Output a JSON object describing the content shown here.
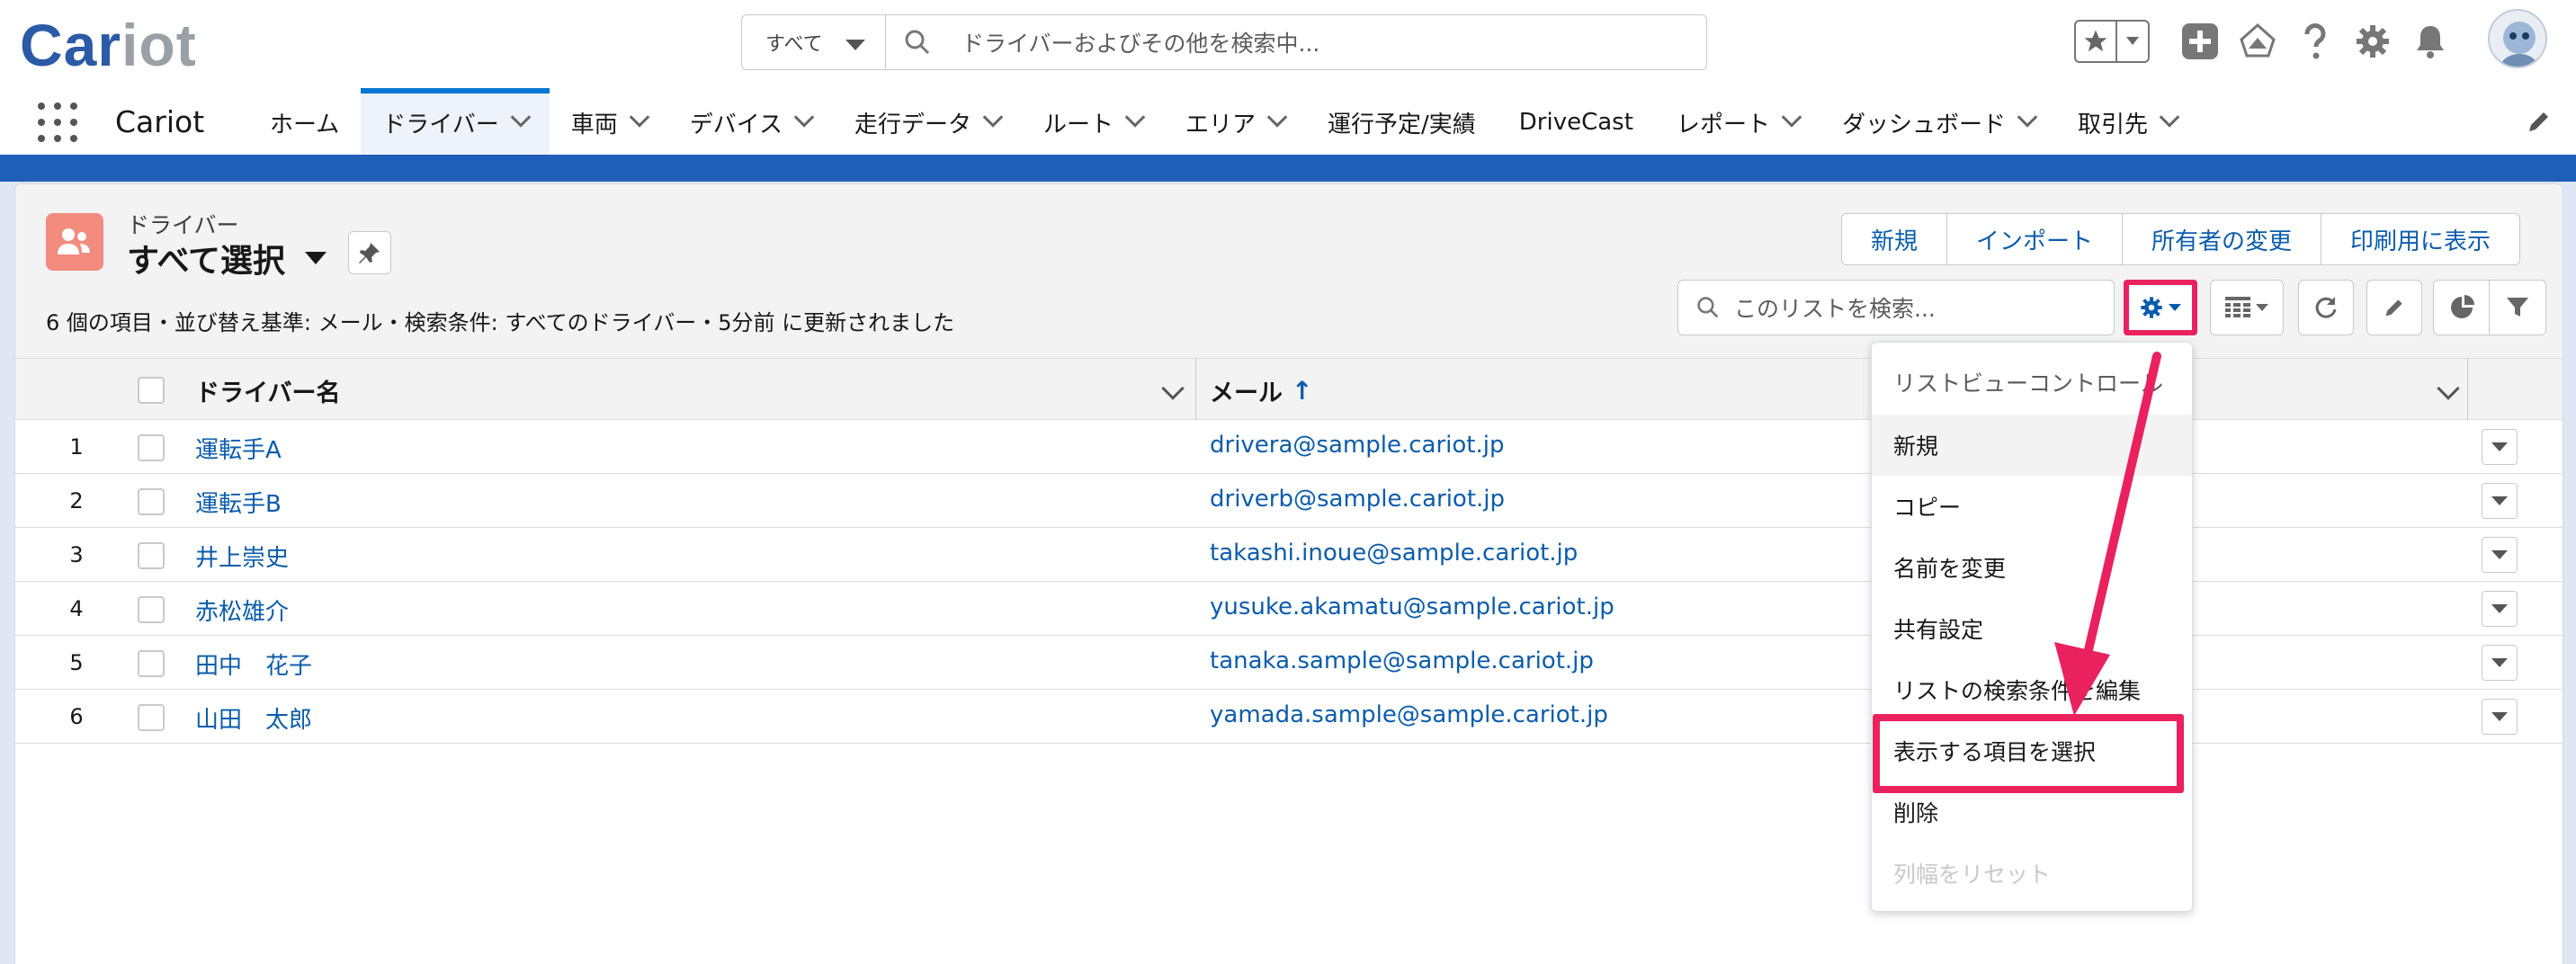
{
  "header": {
    "logo_main": "Car",
    "logo_accent": "iot",
    "search_scope": "すべて",
    "search_placeholder": "ドライバーおよびその他を検索中..."
  },
  "nav": {
    "app_name": "Cariot",
    "items": [
      {
        "label": "ホーム",
        "has_menu": false,
        "active": false
      },
      {
        "label": "ドライバー",
        "has_menu": true,
        "active": true
      },
      {
        "label": "車両",
        "has_menu": true,
        "active": false
      },
      {
        "label": "デバイス",
        "has_menu": true,
        "active": false
      },
      {
        "label": "走行データ",
        "has_menu": true,
        "active": false
      },
      {
        "label": "ルート",
        "has_menu": true,
        "active": false
      },
      {
        "label": "エリア",
        "has_menu": true,
        "active": false
      },
      {
        "label": "運行予定/実績",
        "has_menu": false,
        "active": false
      },
      {
        "label": "DriveCast",
        "has_menu": false,
        "active": false
      },
      {
        "label": "レポート",
        "has_menu": true,
        "active": false
      },
      {
        "label": "ダッシュボード",
        "has_menu": true,
        "active": false
      },
      {
        "label": "取引先",
        "has_menu": true,
        "active": false
      }
    ]
  },
  "list_view": {
    "object_label": "ドライバー",
    "title": "すべて選択",
    "meta": "6 個の項目・並び替え基準: メール・検索条件: すべてのドライバー・5分前 に更新されました",
    "buttons": {
      "new": "新規",
      "import": "インポート",
      "change_owner": "所有者の変更",
      "printable": "印刷用に表示"
    },
    "search_placeholder": "このリストを検索..."
  },
  "table": {
    "columns": [
      "ドライバー名",
      "メール"
    ],
    "sort_indicator": "↑",
    "rows": [
      {
        "num": "1",
        "name": "運転手A",
        "email": "drivera@sample.cariot.jp"
      },
      {
        "num": "2",
        "name": "運転手B",
        "email": "driverb@sample.cariot.jp"
      },
      {
        "num": "3",
        "name": "井上崇史",
        "email": "takashi.inoue@sample.cariot.jp"
      },
      {
        "num": "4",
        "name": "赤松雄介",
        "email": "yusuke.akamatu@sample.cariot.jp"
      },
      {
        "num": "5",
        "name": "田中　花子",
        "email": "tanaka.sample@sample.cariot.jp"
      },
      {
        "num": "6",
        "name": "山田　太郎",
        "email": "yamada.sample@sample.cariot.jp"
      }
    ]
  },
  "dropdown": {
    "header": "リストビューコントロール",
    "items": [
      {
        "label": "新規"
      },
      {
        "label": "コピー"
      },
      {
        "label": "名前を変更"
      },
      {
        "label": "共有設定"
      },
      {
        "label": "リストの検索条件を編集"
      },
      {
        "label": "表示する項目を選択"
      },
      {
        "label": "削除"
      },
      {
        "label": "列幅をリセット"
      }
    ]
  },
  "colors": {
    "brand_blue": "#2b5aa6",
    "link_blue": "#0b5cab",
    "highlight_pink": "#e9225f",
    "object_icon": "#f38b7e"
  }
}
